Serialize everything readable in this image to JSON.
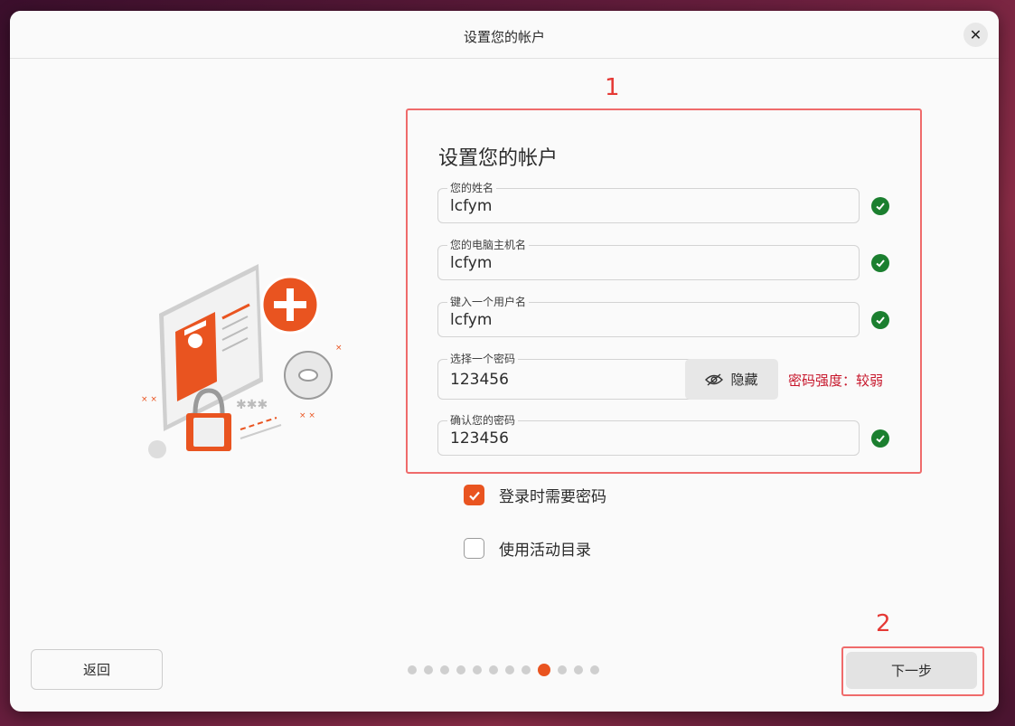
{
  "window": {
    "title": "设置您的帐户"
  },
  "annotations": {
    "form_marker": "1",
    "next_marker": "2"
  },
  "form": {
    "heading": "设置您的帐户",
    "fields": [
      {
        "label": "您的姓名",
        "value": "lcfym",
        "valid": true
      },
      {
        "label": "您的电脑主机名",
        "value": "lcfym",
        "valid": true
      },
      {
        "label": "键入一个用户名",
        "value": "lcfym",
        "valid": true
      },
      {
        "label": "选择一个密码",
        "value": "123456",
        "reveal_label": "隐藏",
        "strength_text": "密码强度：较弱"
      },
      {
        "label": "确认您的密码",
        "value": "123456",
        "valid": true
      }
    ]
  },
  "options": {
    "require_password": {
      "label": "登录时需要密码",
      "checked": true
    },
    "active_directory": {
      "label": "使用活动目录",
      "checked": false
    }
  },
  "footer": {
    "back_label": "返回",
    "next_label": "下一步",
    "progress": {
      "total": 12,
      "current": 9
    }
  },
  "colors": {
    "accent": "#e95420",
    "valid": "#1b7f2f",
    "weak": "#c7162b",
    "annotation": "#e53935"
  },
  "icons": [
    "close-icon",
    "check-icon",
    "eye-icon",
    "checkbox-check-icon"
  ]
}
